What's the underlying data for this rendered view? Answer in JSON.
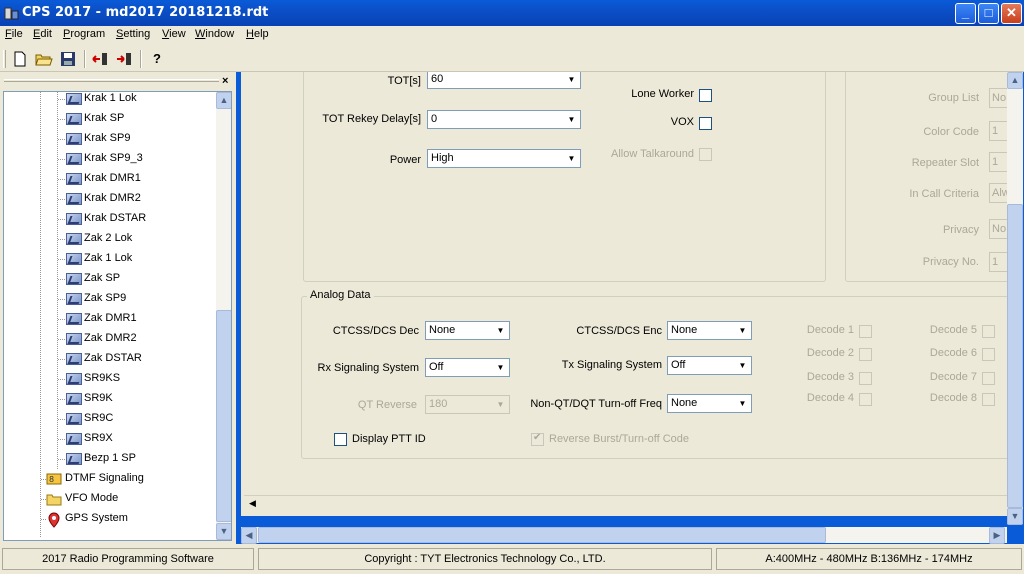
{
  "window": {
    "title": "CPS 2017 - md2017 20181218.rdt",
    "min_btn": "_",
    "max_btn": "□",
    "close_btn": "✕"
  },
  "menu": [
    {
      "label": "File"
    },
    {
      "label": "Edit"
    },
    {
      "label": "Program"
    },
    {
      "label": "Setting"
    },
    {
      "label": "View"
    },
    {
      "label": "Window"
    },
    {
      "label": "Help"
    }
  ],
  "toolbar": {
    "new_glyph": "🗋",
    "open_glyph": "📂",
    "save_glyph": "💾",
    "read_glyph": "⇠",
    "write_glyph": "⇢",
    "help_glyph": "?"
  },
  "tree": {
    "close_glyph": "×",
    "channels": [
      "Krak 1 Lok",
      "Krak SP",
      "Krak SP9",
      "Krak SP9_3",
      "Krak DMR1",
      "Krak DMR2",
      "Krak DSTAR",
      "Zak 2 Lok",
      "Zak 1 Lok",
      "Zak SP",
      "Zak SP9",
      "Zak DMR1",
      "Zak DMR2",
      "Zak DSTAR",
      "SR9KS",
      "SR9K",
      "SR9C",
      "SR9X",
      "Bezp 1 SP"
    ],
    "folders": [
      "DTMF Signaling",
      "VFO Mode",
      "GPS System"
    ]
  },
  "digital": {
    "tot_label": "TOT[s]",
    "tot_value": "60",
    "rekey_label": "TOT Rekey Delay[s]",
    "rekey_value": "0",
    "power_label": "Power",
    "power_value": "High",
    "lone_worker_label": "Lone Worker",
    "vox_label": "VOX",
    "talkaround_label": "Allow Talkaround",
    "group_list_label": "Group List",
    "group_list_value": "No",
    "color_code_label": "Color Code",
    "color_code_value": "1",
    "repeater_slot_label": "Repeater Slot",
    "repeater_slot_value": "1",
    "in_call_label": "In Call Criteria",
    "in_call_value": "Alw",
    "privacy_label": "Privacy",
    "privacy_value": "No",
    "privacy_no_label": "Privacy No.",
    "privacy_no_value": "1"
  },
  "analog": {
    "group_title": "Analog Data",
    "ctcss_dec_label": "CTCSS/DCS Dec",
    "ctcss_dec_value": "None",
    "ctcss_enc_label": "CTCSS/DCS Enc",
    "ctcss_enc_value": "None",
    "rx_sig_label": "Rx Signaling System",
    "rx_sig_value": "Off",
    "tx_sig_label": "Tx Signaling System",
    "tx_sig_value": "Off",
    "qt_rev_label": "QT Reverse",
    "qt_rev_value": "180",
    "nonqt_label": "Non-QT/DQT Turn-off Freq",
    "nonqt_value": "None",
    "display_ptt_label": "Display PTT ID",
    "rev_burst_label": "Reverse Burst/Turn-off Code",
    "decodes": [
      "Decode 1",
      "Decode 2",
      "Decode 3",
      "Decode 4",
      "Decode 5",
      "Decode 6",
      "Decode 7",
      "Decode 8"
    ]
  },
  "status": {
    "left": "2017 Radio Programming Software",
    "middle": "Copyright : TYT Electronics Technology Co., LTD.",
    "right": "A:400MHz - 480MHz B:136MHz - 174MHz"
  }
}
